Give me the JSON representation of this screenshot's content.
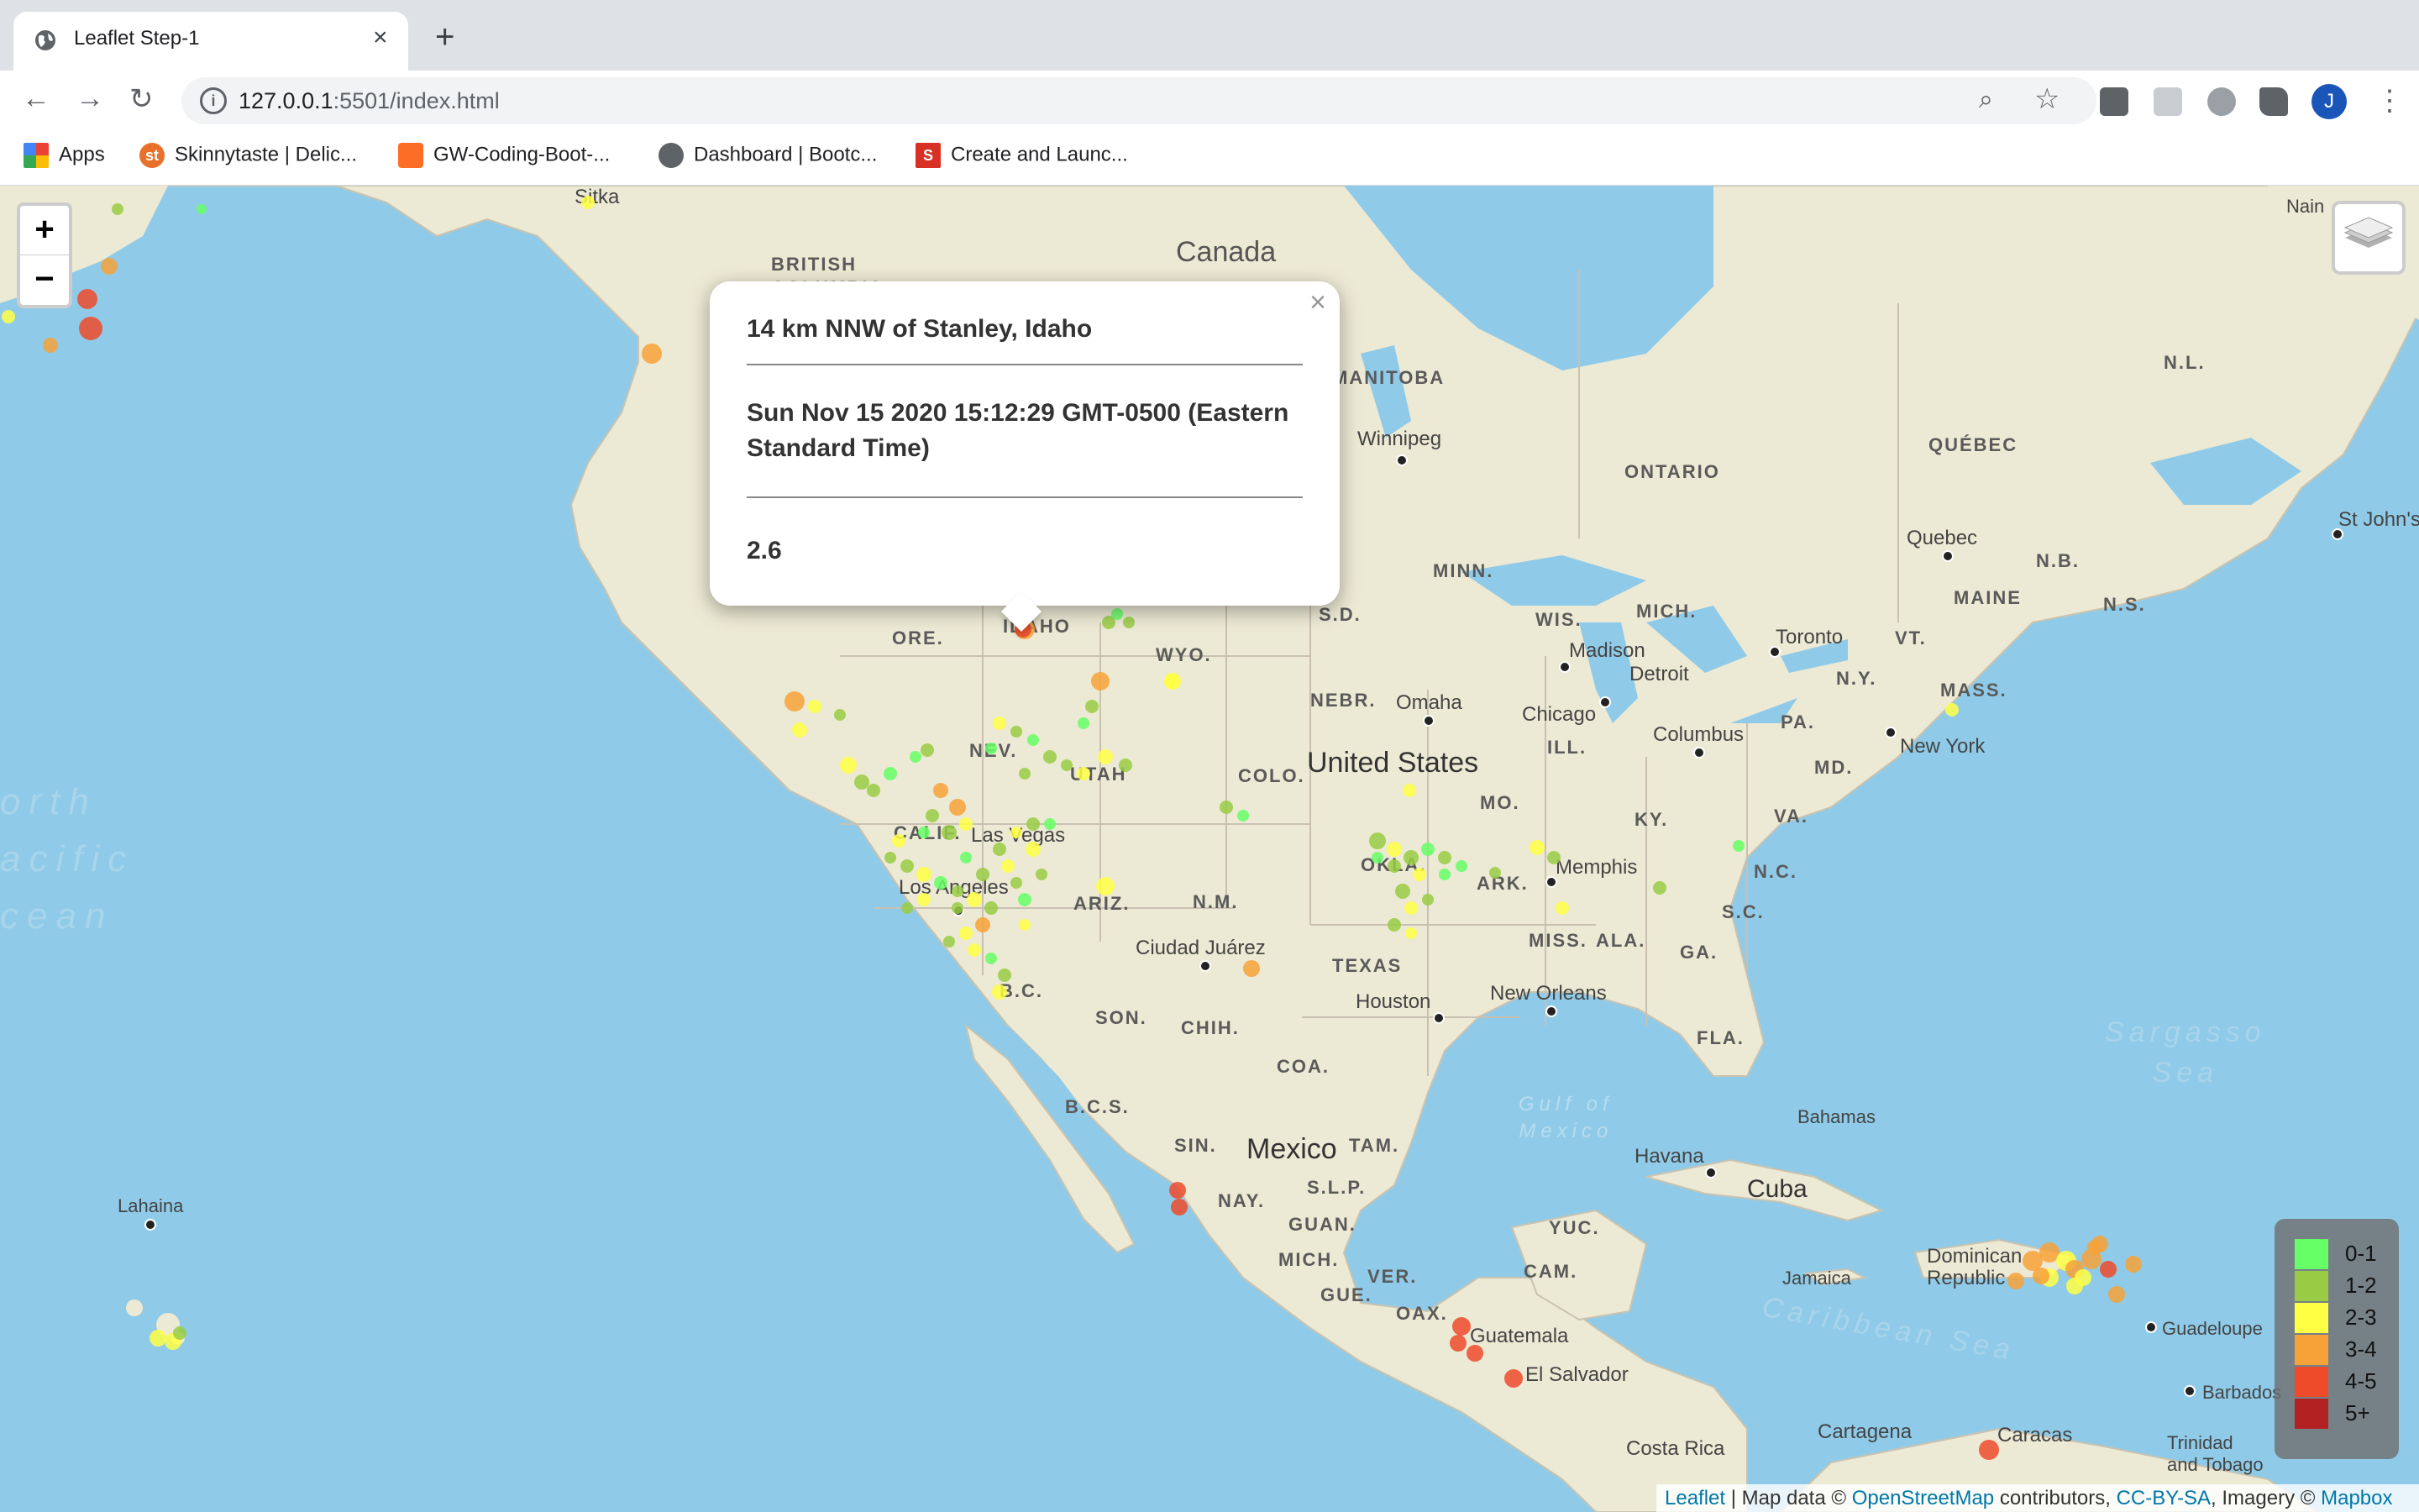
{
  "browser": {
    "tab_title": "Leaflet Step-1",
    "url_host": "127.0.0.1",
    "url_path": ":5501/index.html",
    "avatar_letter": "J",
    "bookmarks": [
      {
        "label": "Apps",
        "icon": "apps-grid-icon"
      },
      {
        "label": "Skinnytaste | Delic...",
        "icon": "skinnytaste-icon"
      },
      {
        "label": "GW-Coding-Boot-...",
        "icon": "gitlab-icon"
      },
      {
        "label": "Dashboard | Bootc...",
        "icon": "globe-icon"
      },
      {
        "label": "Create and Launc...",
        "icon": "s-logo-icon"
      }
    ]
  },
  "map": {
    "labels": {
      "canada": "Canada",
      "united_states": "United States",
      "mexico": "Mexico",
      "cuba": "Cuba",
      "british_columbia": "BRITISH\nCOLUMBIA",
      "manitoba": "MANITOBA",
      "ontario": "ONTARIO",
      "quebec_prov": "QUÉBEC",
      "nl": "N.L.",
      "nb": "N.B.",
      "ns": "N.S.",
      "ore": "ORE.",
      "idaho": "IDAHO",
      "wyo": "WYO.",
      "nev": "NEV.",
      "utah": "UTAH",
      "colo": "COLO.",
      "calif": "CALIF.",
      "ariz": "ARIZ.",
      "nm": "N.M.",
      "texas": "TEXAS",
      "nebr": "NEBR.",
      "sd": "S.D.",
      "minn": "MINN.",
      "wis": "WIS.",
      "mich": "MICH.",
      "ill": "ILL.",
      "mo": "MO.",
      "ky": "KY.",
      "ark": "ARK.",
      "okla": "OKLA.",
      "miss": "MISS.",
      "ala": "ALA.",
      "ga": "GA.",
      "sc": "S.C.",
      "nc": "N.C.",
      "va": "VA.",
      "pa": "PA.",
      "md": "MD.",
      "ny": "N.Y.",
      "mass": "MASS.",
      "vt": "VT.",
      "maine": "MAINE",
      "fla": "FLA.",
      "bc": "B.C.",
      "son": "SON.",
      "chih": "CHIH.",
      "coa": "COA.",
      "bcs": "B.C.S.",
      "sin": "SIN.",
      "nay": "NAY.",
      "tam": "TAM.",
      "slp": "S.L.P.",
      "guan": "GUAN.",
      "mich_mx": "MICH.",
      "gue": "GUE.",
      "ver": "VER.",
      "oax": "OAX.",
      "yuc": "YUC.",
      "cam": "CAM.",
      "sitka": "Sitka",
      "winnipeg": "Winnipeg",
      "toronto": "Toronto",
      "quebec_city": "Quebec",
      "st_johns": "St John's",
      "detroit": "Detroit",
      "madison": "Madison",
      "chicago": "Chicago",
      "omaha": "Omaha",
      "columbus": "Columbus",
      "new_york": "New York",
      "memphis": "Memphis",
      "las_vegas": "Las Vegas",
      "los_angeles": "Los Angeles",
      "ciudad_juarez": "Ciudad Juárez",
      "houston": "Houston",
      "new_orleans": "New Orleans",
      "havana": "Havana",
      "bahamas": "Bahamas",
      "jamaica": "Jamaica",
      "dominican": "Dominican\nRepublic",
      "guadeloupe": "Guadeloupe",
      "barbados": "Barbados",
      "trinidad": "Trinidad\nand Tobago",
      "guatemala": "Guatemala",
      "el_salvador": "El Salvador",
      "costa_rica": "Costa Rica",
      "cartagena": "Cartagena",
      "caracas": "Caracas",
      "lahaina": "Lahaina",
      "nain": "Nain",
      "north_pacific": "orth\nacific\ncean",
      "gulf_mexico": "Gulf of\nMexico",
      "caribbean": "Caribbean Sea",
      "sargasso": "Sargasso\nSea"
    },
    "popup": {
      "place": "14 km NNW of Stanley, Idaho",
      "time": "Sun Nov 15 2020 15:12:29 GMT-0500 (Eastern Standard Time)",
      "magnitude": "2.6"
    },
    "legend": [
      {
        "label": "0-1",
        "color": "#66ff66"
      },
      {
        "label": "1-2",
        "color": "#99cc44"
      },
      {
        "label": "2-3",
        "color": "#ffff44"
      },
      {
        "label": "3-4",
        "color": "#f7a238"
      },
      {
        "label": "4-5",
        "color": "#ee4b2b"
      },
      {
        "label": "5+",
        "color": "#b22222"
      }
    ],
    "zoom_in": "+",
    "zoom_out": "−",
    "attribution": {
      "leaflet": "Leaflet",
      "sep1": " | Map data © ",
      "osm": "OpenStreetMap",
      "sep2": " contributors, ",
      "ccbysa": "CC-BY-SA",
      "sep3": ", Imagery © ",
      "mapbox": "Mapbox"
    }
  }
}
